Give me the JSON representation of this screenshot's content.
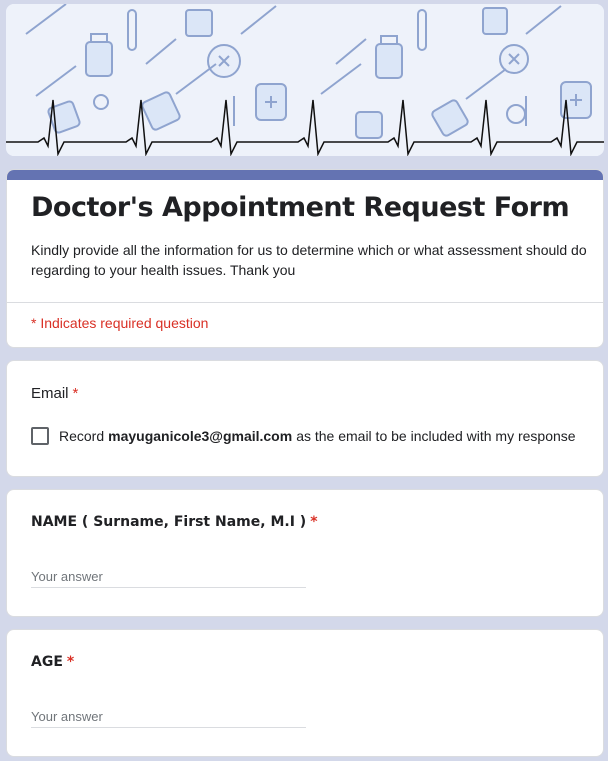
{
  "banner": {
    "icon": "medical-ecg-pattern-banner"
  },
  "form": {
    "title": "Doctor's Appointment Request Form",
    "description": "Kindly provide all the information for us to determine which or what assessment should do regarding to your health issues. Thank you",
    "required_note": "* Indicates required question",
    "accent_color": "#6473b2",
    "required_color": "#d93025"
  },
  "email": {
    "label": "Email",
    "star": "*",
    "record_prefix": "Record",
    "record_email": "mayuganicole3@gmail.com",
    "record_suffix": "as the email to be included with my response"
  },
  "questions": [
    {
      "label": "NAME ( Surname, First Name, M.I )",
      "star": "*",
      "placeholder": "Your answer"
    },
    {
      "label": "AGE",
      "star": "*",
      "placeholder": "Your answer"
    }
  ]
}
